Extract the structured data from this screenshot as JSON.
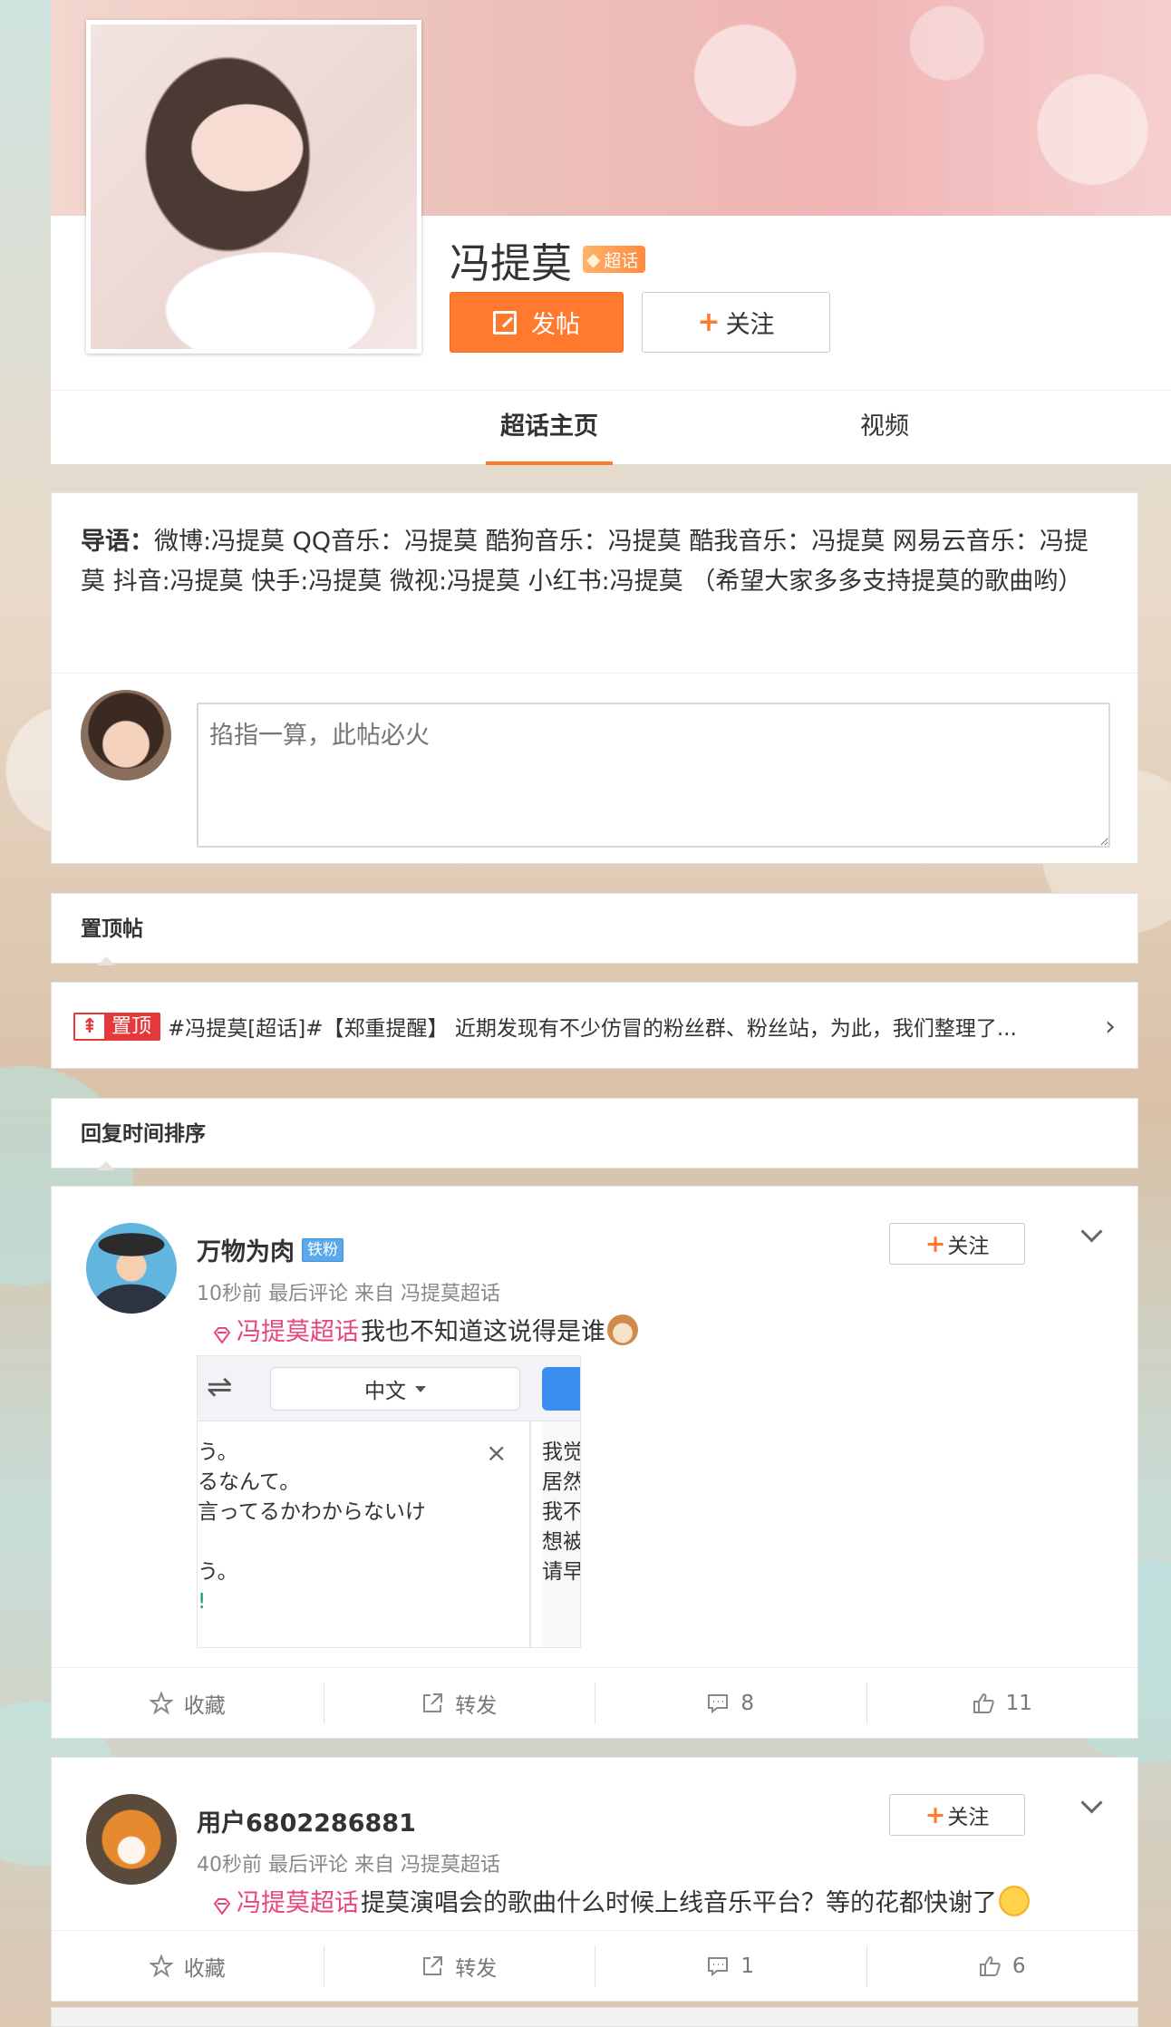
{
  "header": {
    "topic_name": "冯提莫",
    "super_badge": "超话",
    "post_button": "发帖",
    "follow_button": "关注",
    "tabs": [
      {
        "label": "超话主页",
        "active": true
      },
      {
        "label": "视频",
        "active": false
      }
    ]
  },
  "guide": {
    "label": "导语：",
    "text": "微博:冯提莫 QQ音乐：冯提莫 酷狗音乐：冯提莫 酷我音乐：冯提莫 网易云音乐：冯提莫 抖音:冯提莫 快手:冯提莫 微视:冯提莫 小红书:冯提莫 （希望大家多多支持提莫的歌曲哟）"
  },
  "compose": {
    "placeholder": "掐指一算，此帖必火"
  },
  "pinned": {
    "section_title": "置顶帖",
    "badge": "置顶",
    "badge_icon": "⇞",
    "text": "#冯提莫[超话]#【郑重提醒】 近期发现有不少仿冒的粉丝群、粉丝站，为此，我们整理了...",
    "chevron": "›"
  },
  "sort": {
    "section_title": "回复时间排序"
  },
  "posts": [
    {
      "username": "万物为肉",
      "fan_badge": "铁粉",
      "meta": "10秒前 最后评论 来自 冯提莫超话",
      "follow_label": "关注",
      "topic_link": "冯提莫超话",
      "text": "我也不知道这说得是谁",
      "image": {
        "swap_icon": "⇌",
        "language": "中文",
        "close": "×",
        "left_lines": [
          "う。",
          "るなんて。",
          "言ってるかわからないけ",
          "",
          "う。",
          "!"
        ],
        "right_lines": [
          "我觉",
          "居然",
          "我不",
          "想被",
          "请早"
        ]
      },
      "actions": {
        "collect": "收藏",
        "forward": "转发",
        "comments": "8",
        "likes": "11"
      }
    },
    {
      "username": "用户6802286881",
      "meta": "40秒前 最后评论 来自 冯提莫超话",
      "follow_label": "关注",
      "topic_link": "冯提莫超话",
      "text": " 提莫演唱会的歌曲什么时候上线音乐平台？等的花都快谢了",
      "actions": {
        "collect": "收藏",
        "forward": "转发",
        "comments": "1",
        "likes": "6"
      }
    }
  ],
  "colors": {
    "accent": "#ff7a2f",
    "topic_pink": "#e8457a",
    "pin_red": "#e5383b",
    "fan_blue": "#5ba8ea"
  }
}
